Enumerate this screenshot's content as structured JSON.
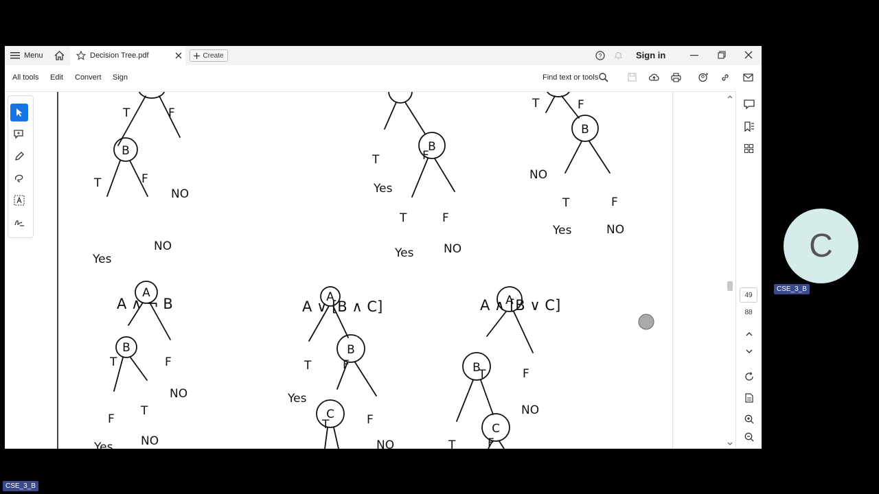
{
  "titlebar": {
    "menu_label": "Menu",
    "tab_title": "Decision Tree.pdf",
    "create_label": "Create",
    "sign_in_label": "Sign in"
  },
  "toolbar": {
    "items": [
      "All tools",
      "Edit",
      "Convert",
      "Sign"
    ],
    "find_label": "Find text or tools"
  },
  "page_nav": {
    "current": "49",
    "total": "88"
  },
  "document": {
    "formulas": [
      "A ∧ ¬ B",
      "A ∨ [B ∧ C]",
      "A ∧ [B ∨ C]"
    ],
    "branch_true": "T",
    "branch_false": "F",
    "leaf_yes": "Yes",
    "leaf_no": "NO",
    "node_a": "A",
    "node_b": "B",
    "node_c": "C"
  },
  "participant": {
    "initial": "C",
    "name": "CSE_3_B"
  },
  "bottom_label": "CSE_3_B",
  "icons": [
    "menu-icon",
    "home-icon",
    "star-icon",
    "close-tab-icon",
    "plus-icon",
    "help-icon",
    "bell-icon",
    "minimize-icon",
    "restore-icon",
    "close-icon",
    "search-icon",
    "save-icon",
    "upload-icon",
    "print-icon",
    "share-icon",
    "link-icon",
    "mail-icon",
    "select-icon",
    "comment-icon",
    "highlight-icon",
    "draw-icon",
    "text-select-icon",
    "sign-icon",
    "comments-panel-icon",
    "bookmark-icon",
    "thumbnails-icon",
    "chevron-up-icon",
    "chevron-down-icon",
    "refresh-icon",
    "page-icon",
    "zoom-in-icon",
    "zoom-out-icon"
  ]
}
